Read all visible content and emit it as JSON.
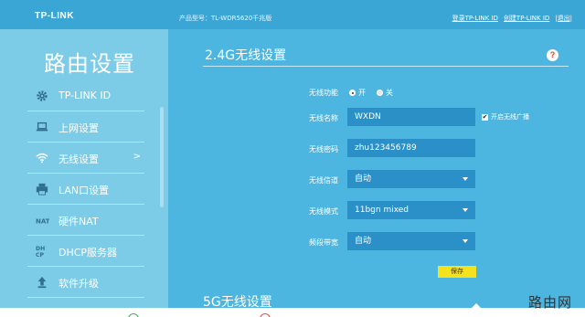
{
  "header": {
    "logo": "TP-LINK",
    "model": "产品型号：TL-WDR5620千兆版",
    "links": [
      "登录TP-LINK ID",
      "创建TP-LINK ID",
      "|退出|"
    ]
  },
  "sidebar": {
    "title": "路由设置",
    "items": [
      {
        "label": "TP-LINK ID",
        "icon": "gear-icon"
      },
      {
        "label": "上网设置",
        "icon": "laptop-icon"
      },
      {
        "label": "无线设置",
        "icon": "wifi-icon",
        "active": true,
        "chevron": ">"
      },
      {
        "label": "LAN口设置",
        "icon": "printer-icon"
      },
      {
        "label": "硬件NAT",
        "icon": "nat-icon"
      },
      {
        "label": "DHCP服务器",
        "icon": "dhcp-icon"
      },
      {
        "label": "软件升级",
        "icon": "upload-icon"
      }
    ]
  },
  "main": {
    "section_title": "2.4G无线设置",
    "help": "?",
    "wireless_function": {
      "label": "无线功能",
      "on": "开",
      "off": "关",
      "selected": "开"
    },
    "ssid": {
      "label": "无线名称",
      "value": "WXDN"
    },
    "broadcast": {
      "label": "开启无线广播",
      "checked": true,
      "mark": "✔"
    },
    "password": {
      "label": "无线密码",
      "value": "zhu123456789"
    },
    "channel": {
      "label": "无线信道",
      "value": "自动"
    },
    "mode": {
      "label": "无线模式",
      "value": "11bgn mixed"
    },
    "bandwidth": {
      "label": "频段带宽",
      "value": "自动"
    },
    "save_label": "保存",
    "section2_title": "5G无线设置"
  },
  "watermark": "路由网",
  "colors": {
    "accent": "#4db6e0",
    "sidebar": "#7ccce8",
    "field": "#2b90c8",
    "save": "#f5e21e"
  }
}
